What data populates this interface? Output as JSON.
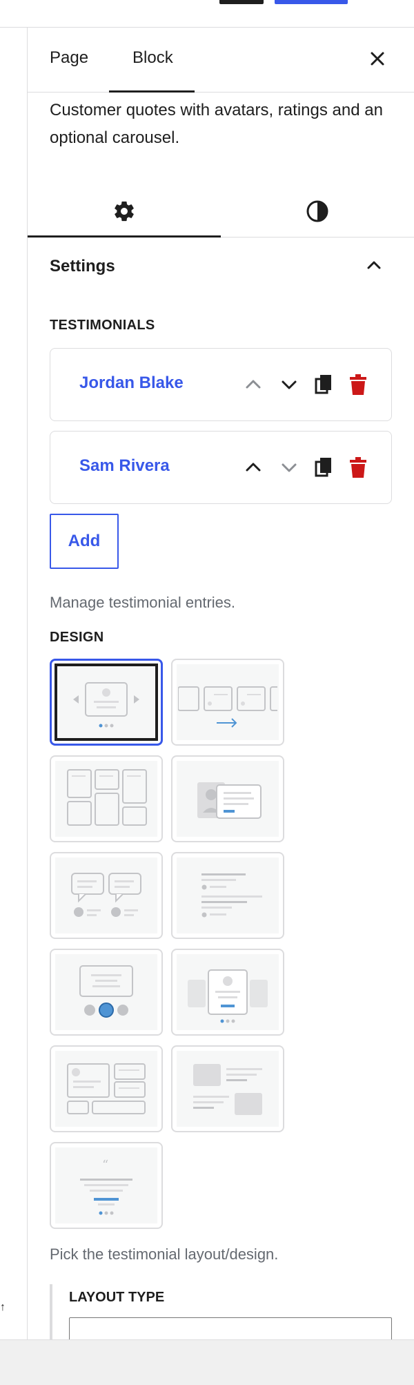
{
  "sidebar": {
    "tabs": [
      {
        "label": "Page",
        "active": false
      },
      {
        "label": "Block",
        "active": true
      }
    ],
    "block_description": "Customer quotes with avatars, ratings and an optional carousel.",
    "inner_tabs": [
      {
        "icon": "gear-icon",
        "active": true
      },
      {
        "icon": "contrast-icon",
        "active": false
      }
    ]
  },
  "settings_panel": {
    "title": "Settings",
    "testimonials_label": "TESTIMONIALS",
    "items": [
      {
        "name": "Jordan Blake",
        "move_up_disabled": true,
        "move_down_disabled": false
      },
      {
        "name": "Sam Rivera",
        "move_up_disabled": false,
        "move_down_disabled": true
      }
    ],
    "add_label": "Add",
    "testimonials_help": "Manage testimonial entries.",
    "design_label": "DESIGN",
    "design_options": [
      {
        "id": "carousel",
        "selected": true
      },
      {
        "id": "slider-row"
      },
      {
        "id": "masonry"
      },
      {
        "id": "profile-card"
      },
      {
        "id": "speech-bubbles"
      },
      {
        "id": "text-list"
      },
      {
        "id": "avatar-nav"
      },
      {
        "id": "spotlight"
      },
      {
        "id": "mixed-grid"
      },
      {
        "id": "alternating"
      },
      {
        "id": "quote-slider"
      }
    ],
    "design_help": "Pick the testimonial layout/design.",
    "layout_type_label": "LAYOUT TYPE"
  },
  "colors": {
    "accent": "#3858e9",
    "delete": "#cc1818",
    "text": "#1e1e1e",
    "muted": "#646970",
    "border": "#dcdcde"
  }
}
